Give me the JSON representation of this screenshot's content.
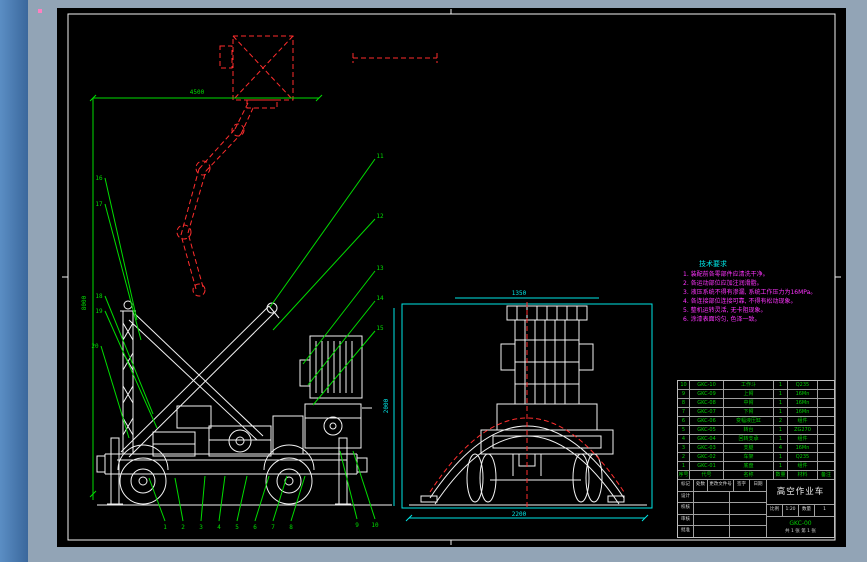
{
  "window": {
    "background": "#92a4b6",
    "side_panel": "#4a7cb0",
    "canvas": "#000000"
  },
  "colors": {
    "drawing_lines": "#f2f2f2",
    "phantom_lines": "#ff2d2d",
    "leader_lines": "#00dd00",
    "dimension_lines": "#00e6e6",
    "notes_title": "#00e6e6",
    "notes_text": "#ff33ff",
    "table_text": "#00cc00"
  },
  "notes": {
    "title": "技术要求",
    "lines": [
      "1. 装配前各零部件应清洗干净。",
      "2. 各运动部位应加注润滑脂。",
      "3. 液压系统不得有渗漏, 系统工作压力为16MPa。",
      "4. 各连接部位连接可靠, 不得有松动现象。",
      "5. 整机运转灵活, 无卡阻现象。",
      "6. 涂漆表面均匀, 色泽一致。"
    ]
  },
  "dimensions": {
    "max_height": "8000",
    "max_reach": "4500",
    "rear_width": "2200",
    "rear_height": "2000",
    "rear_top": "1350"
  },
  "callouts": {
    "bottom": [
      "1",
      "2",
      "3",
      "4",
      "5",
      "6",
      "7",
      "8"
    ],
    "under_cab": [
      "9",
      "10"
    ],
    "right_fan": [
      "11",
      "12",
      "13",
      "14",
      "15"
    ],
    "left_stack": [
      "16",
      "17",
      "18",
      "19",
      "20"
    ]
  },
  "titleblock": {
    "bom_header": {
      "no": "序号",
      "code": "代号",
      "name": "名称",
      "qty": "数量",
      "mat": "材料",
      "note": "备注"
    },
    "bom": [
      {
        "no": "10",
        "code": "GKC-10",
        "name": "工作斗",
        "qty": "1",
        "mat": "Q235",
        "note": ""
      },
      {
        "no": "9",
        "code": "GKC-09",
        "name": "上臂",
        "qty": "1",
        "mat": "16Mn",
        "note": ""
      },
      {
        "no": "8",
        "code": "GKC-08",
        "name": "中臂",
        "qty": "1",
        "mat": "16Mn",
        "note": ""
      },
      {
        "no": "7",
        "code": "GKC-07",
        "name": "下臂",
        "qty": "1",
        "mat": "16Mn",
        "note": ""
      },
      {
        "no": "6",
        "code": "GKC-06",
        "name": "变幅液压缸",
        "qty": "2",
        "mat": "组件",
        "note": ""
      },
      {
        "no": "5",
        "code": "GKC-05",
        "name": "转台",
        "qty": "1",
        "mat": "ZG270",
        "note": ""
      },
      {
        "no": "4",
        "code": "GKC-04",
        "name": "回转支承",
        "qty": "1",
        "mat": "组件",
        "note": ""
      },
      {
        "no": "3",
        "code": "GKC-03",
        "name": "支腿",
        "qty": "4",
        "mat": "16Mn",
        "note": ""
      },
      {
        "no": "2",
        "code": "GKC-02",
        "name": "车架",
        "qty": "1",
        "mat": "Q235",
        "note": ""
      },
      {
        "no": "1",
        "code": "GKC-01",
        "name": "底盘",
        "qty": "1",
        "mat": "组件",
        "note": ""
      }
    ],
    "fields": {
      "mark_label": "标记",
      "count_label": "处数",
      "file_label": "更改文件号",
      "sign_label": "签字",
      "date_label": "日期",
      "design_label": "设计",
      "check_label": "校核",
      "audit_label": "审核",
      "approve_label": "批准",
      "scale_label": "比例",
      "scale_value": "1:20",
      "qty_label": "数量",
      "qty_value": "1",
      "drawing_name": "高空作业车",
      "drawing_no": "GKC-00",
      "sheet_info": "共 1 张 第 1 张"
    }
  }
}
